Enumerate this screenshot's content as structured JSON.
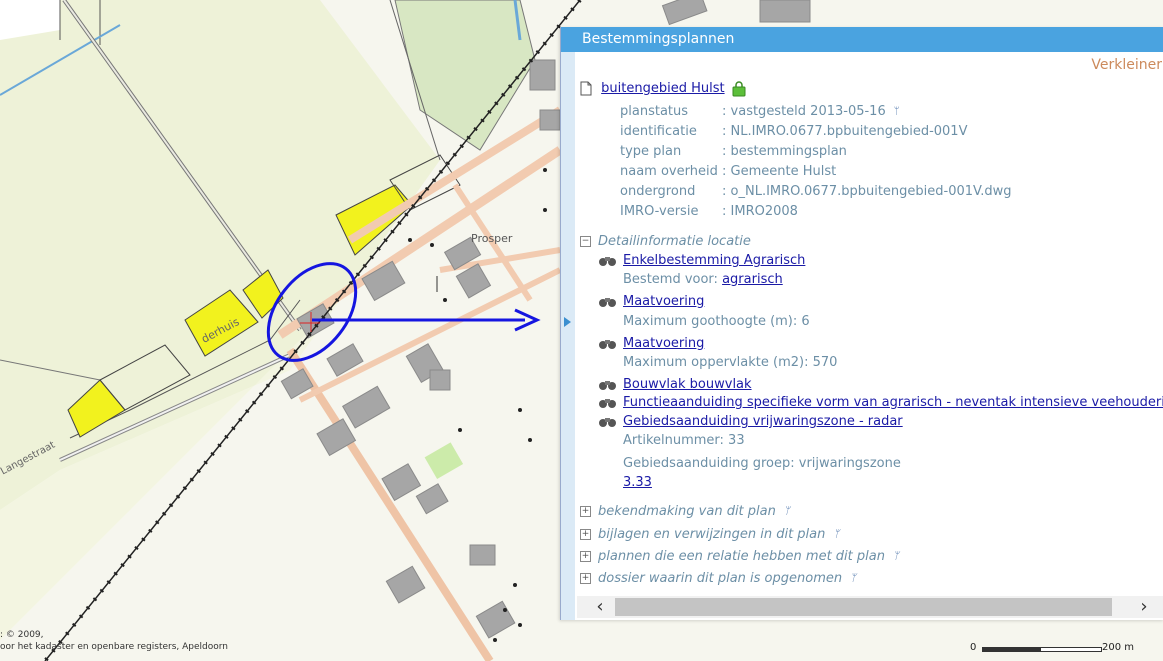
{
  "map": {
    "place_label": "Prosper",
    "partial_label_1": "derhuis",
    "partial_label_2": "Langestraat",
    "copyright_line1": ": © 2009,",
    "copyright_line2": "oor het kadaster en openbare registers, Apeldoorn",
    "scale": {
      "left": "0",
      "right": "200 m"
    }
  },
  "panel": {
    "title": "Bestemmingsplannen",
    "shrink_label": "Verkleiner",
    "plan": {
      "name": "buitengebied Hulst",
      "fields": [
        {
          "key": "planstatus",
          "value": "vastgesteld 2013-05-16"
        },
        {
          "key": "identificatie",
          "value": "NL.IMRO.0677.bpbuitengebied-001V"
        },
        {
          "key": "type plan",
          "value": "bestemmingsplan"
        },
        {
          "key": "naam overheid",
          "value": "Gemeente Hulst"
        },
        {
          "key": "ondergrond",
          "value": "o_NL.IMRO.0677.bpbuitengebied-001V.dwg"
        },
        {
          "key": "IMRO-versie",
          "value": "IMRO2008"
        }
      ],
      "separator": ":"
    },
    "detail": {
      "heading": "Detailinformatie locatie",
      "items": {
        "enkel": {
          "title": "Enkelbestemming Agrarisch",
          "sub_prefix": "Bestemd voor:",
          "sub_link": "agrarisch"
        },
        "maat1": {
          "title": "Maatvoering",
          "sub": "Maximum goothoogte (m): 6"
        },
        "maat2": {
          "title": "Maatvoering",
          "sub": "Maximum oppervlakte (m2): 570"
        },
        "bouwvlak": {
          "title": "Bouwvlak bouwvlak"
        },
        "functie": {
          "title": "Functieaanduiding specifieke vorm van agrarisch - neventak intensieve veehouderij"
        },
        "gebied": {
          "title": "Gebiedsaanduiding vrijwaringszone - radar",
          "sub1": "Artikelnummer: 33",
          "sub2": "Gebiedsaanduiding groep: vrijwaringszone",
          "sub_link": "3.33"
        }
      }
    },
    "sections": [
      "bekendmaking van dit plan",
      "bijlagen en verwijzingen in dit plan",
      "plannen die een relatie hebben met dit plan",
      "dossier waarin dit plan is opgenomen"
    ],
    "expand_symbol": "+",
    "collapse_symbol": "−",
    "info_symbol": "ᛘ",
    "scroll_left": "‹",
    "scroll_right": "›"
  }
}
